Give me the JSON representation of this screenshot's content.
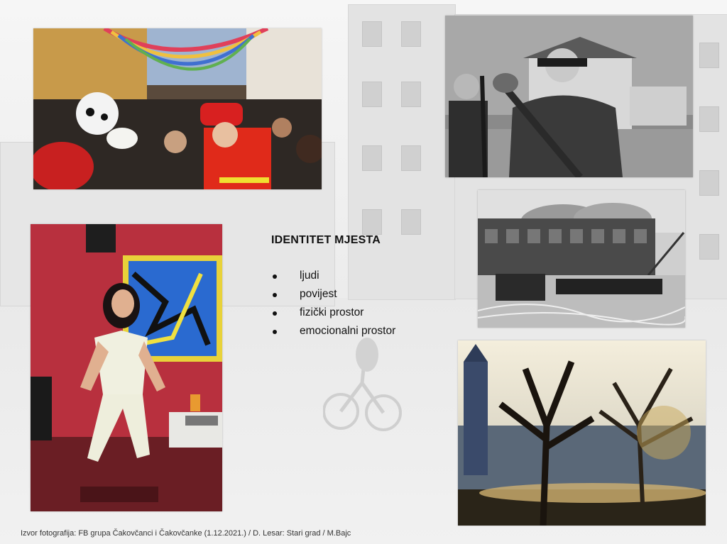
{
  "slide": {
    "title": "IDENTITET MJESTA",
    "bullets": [
      "ljudi",
      "povijest",
      "fizički prostor",
      "emocionalni prostor"
    ],
    "caption": "Izvor fotografija: FB grupa Čakovčanci i Čakovčanke (1.12.2021.) / D. Lesar: Stari grad / M.Bajc"
  },
  "photos": {
    "carnival": "carnival-crowd-photo",
    "firemen": "firemen-with-hose-bw-photo",
    "fire": "burning-building-bw-photo",
    "dancer": "woman-dancing-photo",
    "castle": "castle-trees-sunset-photo"
  },
  "colors": {
    "text": "#111111",
    "background": "#f2f2f2"
  }
}
